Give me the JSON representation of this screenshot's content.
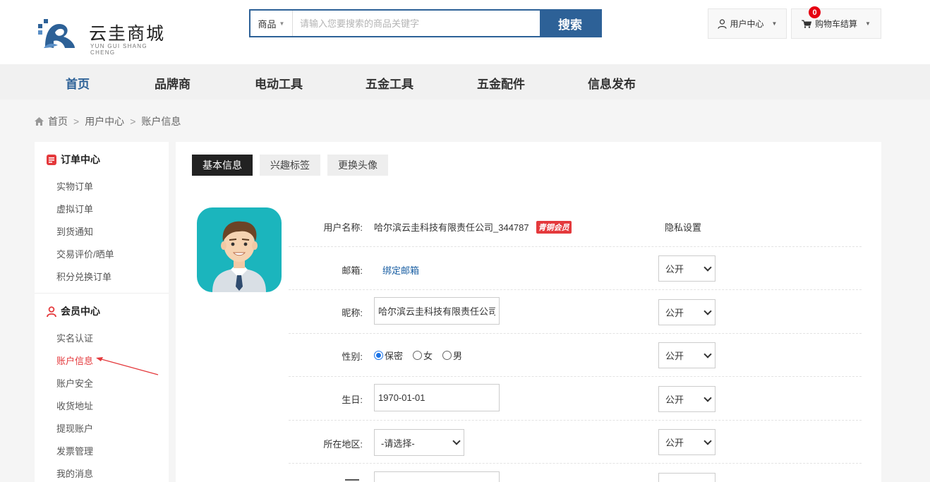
{
  "brand": {
    "name_cn": "云圭商城",
    "name_en": "YUN GUI SHANG CHENG",
    "accent": "#2d6197"
  },
  "search": {
    "category": "商品",
    "placeholder": "请输入您要搜索的商品关键字",
    "button": "搜索"
  },
  "header": {
    "user_center": "用户中心",
    "cart_label": "购物车结算",
    "cart_count": "0"
  },
  "nav": {
    "items": [
      "首页",
      "品牌商",
      "电动工具",
      "五金工具",
      "五金配件",
      "信息发布"
    ],
    "active_index": 0
  },
  "breadcrumb": [
    "首页",
    "用户中心",
    "账户信息"
  ],
  "sidebar": {
    "order_center": {
      "title": "订单中心",
      "items": [
        "实物订单",
        "虚拟订单",
        "到货通知",
        "交易评价/晒单",
        "积分兑换订单"
      ]
    },
    "member_center": {
      "title": "会员中心",
      "items": [
        "实名认证",
        "账户信息",
        "账户安全",
        "收货地址",
        "提现账户",
        "发票管理",
        "我的消息"
      ],
      "active": "账户信息"
    }
  },
  "tabs": {
    "items": [
      "基本信息",
      "兴趣标签",
      "更换头像"
    ],
    "active_index": 0
  },
  "form": {
    "username_label": "用户名称:",
    "username": "哈尔滨云圭科技有限责任公司_344787",
    "vip_badge": "青铜会员",
    "privacy_title": "隐私设置",
    "email_label": "邮箱:",
    "email_link": "绑定邮箱",
    "nickname_label": "昵称:",
    "nickname_value": "哈尔滨云圭科技有限责任公司",
    "gender_label": "性别:",
    "gender_options": [
      "保密",
      "女",
      "男"
    ],
    "gender_selected": "保密",
    "birthday_label": "生日:",
    "birthday_value": "1970-01-01",
    "region_label": "所在地区:",
    "region_value": "-请选择-",
    "privacy_value": "公开"
  },
  "colors": {
    "active_link": "#e4393c",
    "badge_red": "#e60012",
    "avatar_bg": "#1bb5bd"
  }
}
